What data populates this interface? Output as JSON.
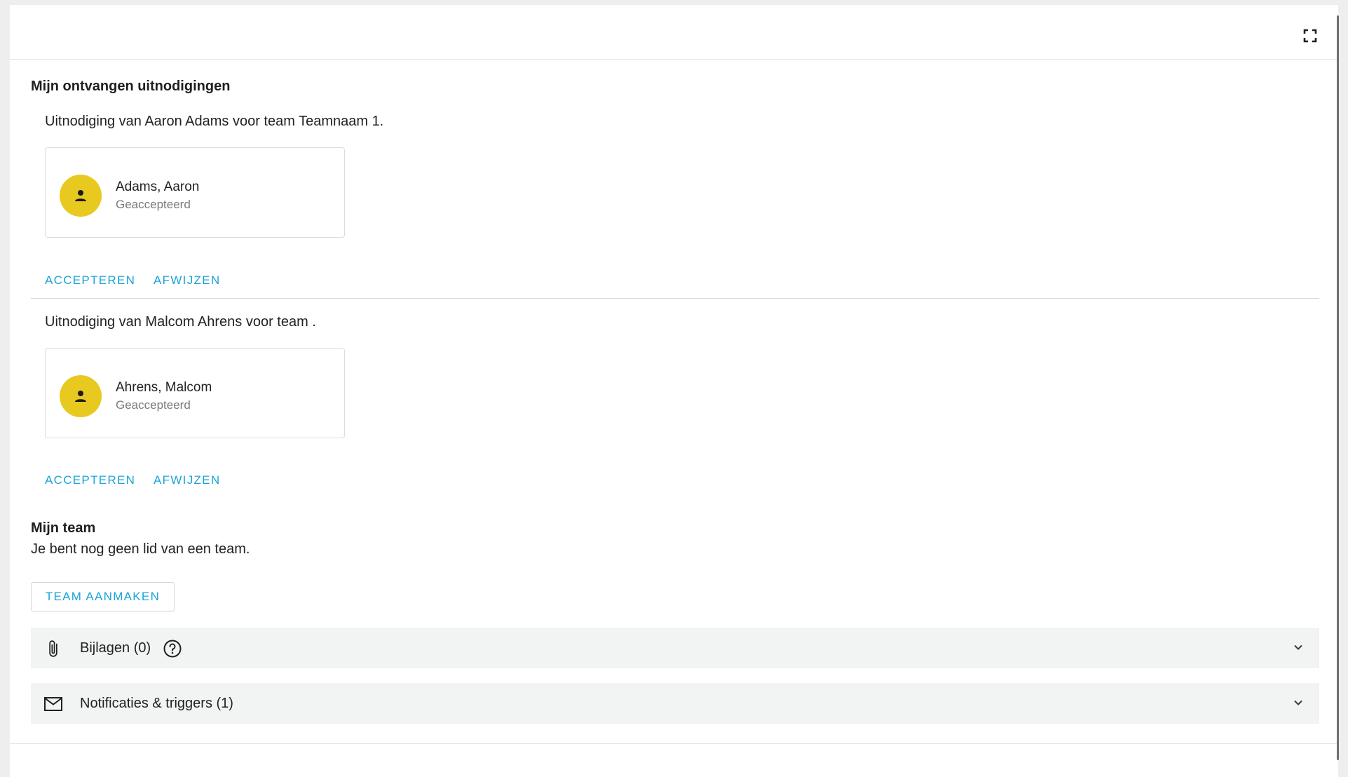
{
  "invitations_section": {
    "title": "Mijn ontvangen uitnodigingen",
    "items": [
      {
        "text": "Uitnodiging van Aaron Adams voor team Teamnaam 1.",
        "person_name": "Adams, Aaron",
        "person_status": "Geaccepteerd",
        "accept_label": "ACCEPTEREN",
        "reject_label": "AFWIJZEN"
      },
      {
        "text": "Uitnodiging van Malcom Ahrens voor team .",
        "person_name": "Ahrens, Malcom",
        "person_status": "Geaccepteerd",
        "accept_label": "ACCEPTEREN",
        "reject_label": "AFWIJZEN"
      }
    ]
  },
  "team_section": {
    "title": "Mijn team",
    "message": "Je bent nog geen lid van een team.",
    "create_button_label": "TEAM AANMAKEN"
  },
  "accordions": [
    {
      "label": "Bijlagen (0)",
      "icon": "paperclip-icon",
      "has_help": true
    },
    {
      "label": "Notificaties & triggers (1)",
      "icon": "envelope-icon",
      "has_help": false
    }
  ],
  "colors": {
    "accent": "#1aa3d9",
    "avatar": "#e8c920",
    "accordion_bg": "#f2f3f3"
  }
}
